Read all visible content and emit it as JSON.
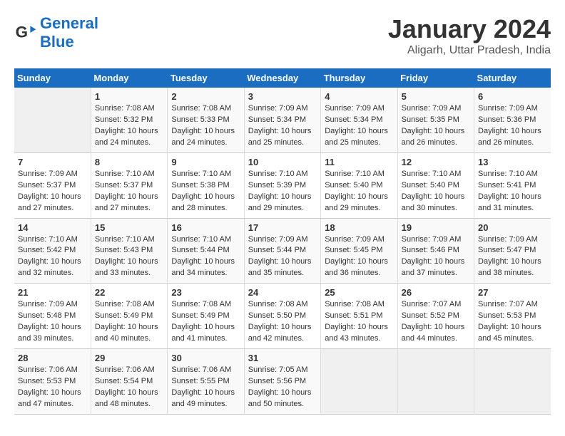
{
  "header": {
    "logo_line1": "General",
    "logo_line2": "Blue",
    "title": "January 2024",
    "subtitle": "Aligarh, Uttar Pradesh, India"
  },
  "weekdays": [
    "Sunday",
    "Monday",
    "Tuesday",
    "Wednesday",
    "Thursday",
    "Friday",
    "Saturday"
  ],
  "weeks": [
    [
      {
        "day": "",
        "info": ""
      },
      {
        "day": "1",
        "info": "Sunrise: 7:08 AM\nSunset: 5:32 PM\nDaylight: 10 hours\nand 24 minutes."
      },
      {
        "day": "2",
        "info": "Sunrise: 7:08 AM\nSunset: 5:33 PM\nDaylight: 10 hours\nand 24 minutes."
      },
      {
        "day": "3",
        "info": "Sunrise: 7:09 AM\nSunset: 5:34 PM\nDaylight: 10 hours\nand 25 minutes."
      },
      {
        "day": "4",
        "info": "Sunrise: 7:09 AM\nSunset: 5:34 PM\nDaylight: 10 hours\nand 25 minutes."
      },
      {
        "day": "5",
        "info": "Sunrise: 7:09 AM\nSunset: 5:35 PM\nDaylight: 10 hours\nand 26 minutes."
      },
      {
        "day": "6",
        "info": "Sunrise: 7:09 AM\nSunset: 5:36 PM\nDaylight: 10 hours\nand 26 minutes."
      }
    ],
    [
      {
        "day": "7",
        "info": "Sunrise: 7:09 AM\nSunset: 5:37 PM\nDaylight: 10 hours\nand 27 minutes."
      },
      {
        "day": "8",
        "info": "Sunrise: 7:10 AM\nSunset: 5:37 PM\nDaylight: 10 hours\nand 27 minutes."
      },
      {
        "day": "9",
        "info": "Sunrise: 7:10 AM\nSunset: 5:38 PM\nDaylight: 10 hours\nand 28 minutes."
      },
      {
        "day": "10",
        "info": "Sunrise: 7:10 AM\nSunset: 5:39 PM\nDaylight: 10 hours\nand 29 minutes."
      },
      {
        "day": "11",
        "info": "Sunrise: 7:10 AM\nSunset: 5:40 PM\nDaylight: 10 hours\nand 29 minutes."
      },
      {
        "day": "12",
        "info": "Sunrise: 7:10 AM\nSunset: 5:40 PM\nDaylight: 10 hours\nand 30 minutes."
      },
      {
        "day": "13",
        "info": "Sunrise: 7:10 AM\nSunset: 5:41 PM\nDaylight: 10 hours\nand 31 minutes."
      }
    ],
    [
      {
        "day": "14",
        "info": "Sunrise: 7:10 AM\nSunset: 5:42 PM\nDaylight: 10 hours\nand 32 minutes."
      },
      {
        "day": "15",
        "info": "Sunrise: 7:10 AM\nSunset: 5:43 PM\nDaylight: 10 hours\nand 33 minutes."
      },
      {
        "day": "16",
        "info": "Sunrise: 7:10 AM\nSunset: 5:44 PM\nDaylight: 10 hours\nand 34 minutes."
      },
      {
        "day": "17",
        "info": "Sunrise: 7:09 AM\nSunset: 5:44 PM\nDaylight: 10 hours\nand 35 minutes."
      },
      {
        "day": "18",
        "info": "Sunrise: 7:09 AM\nSunset: 5:45 PM\nDaylight: 10 hours\nand 36 minutes."
      },
      {
        "day": "19",
        "info": "Sunrise: 7:09 AM\nSunset: 5:46 PM\nDaylight: 10 hours\nand 37 minutes."
      },
      {
        "day": "20",
        "info": "Sunrise: 7:09 AM\nSunset: 5:47 PM\nDaylight: 10 hours\nand 38 minutes."
      }
    ],
    [
      {
        "day": "21",
        "info": "Sunrise: 7:09 AM\nSunset: 5:48 PM\nDaylight: 10 hours\nand 39 minutes."
      },
      {
        "day": "22",
        "info": "Sunrise: 7:08 AM\nSunset: 5:49 PM\nDaylight: 10 hours\nand 40 minutes."
      },
      {
        "day": "23",
        "info": "Sunrise: 7:08 AM\nSunset: 5:49 PM\nDaylight: 10 hours\nand 41 minutes."
      },
      {
        "day": "24",
        "info": "Sunrise: 7:08 AM\nSunset: 5:50 PM\nDaylight: 10 hours\nand 42 minutes."
      },
      {
        "day": "25",
        "info": "Sunrise: 7:08 AM\nSunset: 5:51 PM\nDaylight: 10 hours\nand 43 minutes."
      },
      {
        "day": "26",
        "info": "Sunrise: 7:07 AM\nSunset: 5:52 PM\nDaylight: 10 hours\nand 44 minutes."
      },
      {
        "day": "27",
        "info": "Sunrise: 7:07 AM\nSunset: 5:53 PM\nDaylight: 10 hours\nand 45 minutes."
      }
    ],
    [
      {
        "day": "28",
        "info": "Sunrise: 7:06 AM\nSunset: 5:53 PM\nDaylight: 10 hours\nand 47 minutes."
      },
      {
        "day": "29",
        "info": "Sunrise: 7:06 AM\nSunset: 5:54 PM\nDaylight: 10 hours\nand 48 minutes."
      },
      {
        "day": "30",
        "info": "Sunrise: 7:06 AM\nSunset: 5:55 PM\nDaylight: 10 hours\nand 49 minutes."
      },
      {
        "day": "31",
        "info": "Sunrise: 7:05 AM\nSunset: 5:56 PM\nDaylight: 10 hours\nand 50 minutes."
      },
      {
        "day": "",
        "info": ""
      },
      {
        "day": "",
        "info": ""
      },
      {
        "day": "",
        "info": ""
      }
    ]
  ]
}
